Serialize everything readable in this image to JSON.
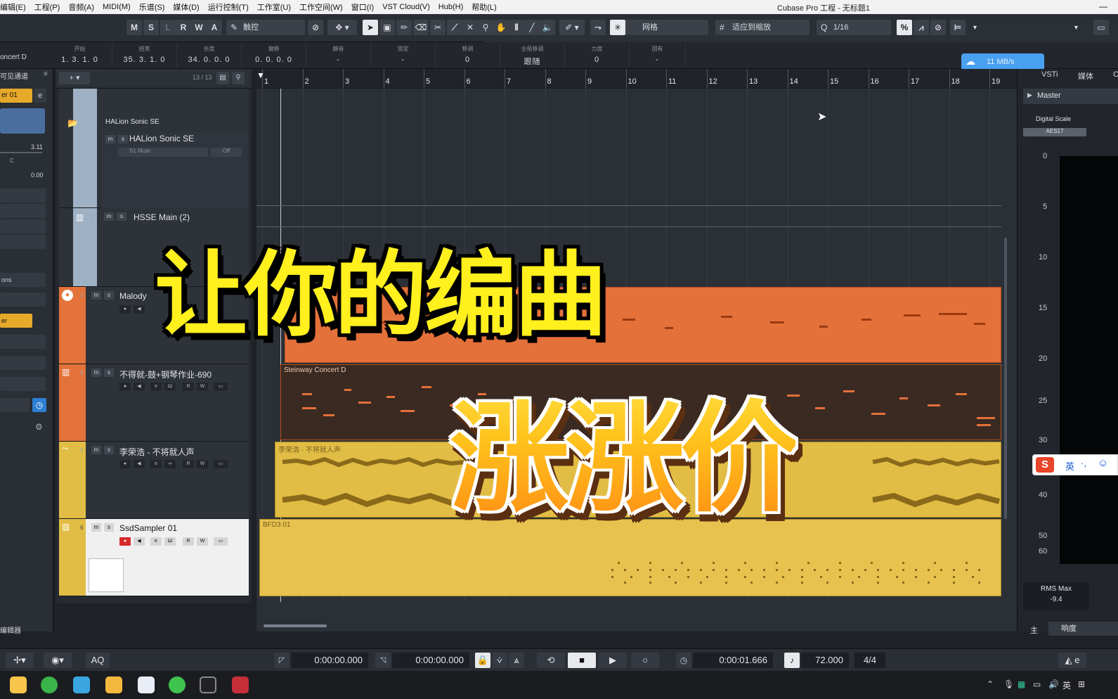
{
  "menubar": {
    "items": [
      "编辑(E)",
      "工程(P)",
      "音频(A)",
      "MIDI(M)",
      "乐谱(S)",
      "媒体(D)",
      "运行控制(T)",
      "工作室(U)",
      "工作空间(W)",
      "窗口(I)",
      "VST Cloud(V)",
      "Hub(H)",
      "帮助(L)"
    ],
    "window_title": "Cubase Pro 工程 - 无标题1"
  },
  "toolbar": {
    "mode_buttons": [
      "M",
      "S",
      "L",
      "R",
      "W",
      "A"
    ],
    "automation_mode": "触控",
    "snap_type": "网格",
    "grid_mode": "适应到缩放",
    "quantize": "1/16"
  },
  "infoline": {
    "track_name": "oncert D",
    "columns": [
      {
        "label": "开始",
        "value": "1. 3. 1.   0"
      },
      {
        "label": "结束",
        "value": "35. 3. 1.   0"
      },
      {
        "label": "长度",
        "value": "34. 0. 0.   0"
      },
      {
        "label": "偏移",
        "value": "0. 0. 0.   0"
      },
      {
        "label": "静音",
        "value": "-"
      },
      {
        "label": "锁定",
        "value": "-"
      },
      {
        "label": "移调",
        "value": "0"
      },
      {
        "label": "全局移调",
        "value": "跟随"
      },
      {
        "label": "力度",
        "value": "0"
      },
      {
        "label": "固有",
        "value": "-"
      }
    ]
  },
  "network_badge": "11 MB/s",
  "inspector": {
    "header": "可见通道",
    "channel": "er 01",
    "volume": "3.11",
    "pan": "C",
    "delay": "0.00",
    "item_a": "ons",
    "item_b": "er",
    "footer": "编辑器"
  },
  "tracklist": {
    "count": "13 / 13",
    "folder_name": "HALion Sonic SE",
    "tracks": [
      {
        "num": "",
        "name": "HALion Sonic SE",
        "sub": "S1 Mute",
        "sub2": "Off"
      },
      {
        "num": "2",
        "name": "HSSE Main (2)"
      },
      {
        "num": "3",
        "name": "Malody"
      },
      {
        "num": "4",
        "name": "不得就-鼓+钢琴作业-690"
      },
      {
        "num": "5",
        "name": "李荣浩 - 不将就人声"
      },
      {
        "num": "6",
        "name": "SsdSampler 01"
      }
    ]
  },
  "ruler": {
    "bars": [
      "1",
      "2",
      "3",
      "4",
      "5",
      "6",
      "7",
      "8",
      "9",
      "10",
      "11",
      "12",
      "13",
      "14",
      "15",
      "16",
      "17",
      "18",
      "19"
    ]
  },
  "events": {
    "piano": "Steinway Concert D",
    "vocal": "李荣浩 - 不将就人声",
    "drums": "BFD3 01"
  },
  "rightzone": {
    "tabs": [
      "VSTi",
      "媒体",
      "C"
    ],
    "master": "Master",
    "scale": "Digital Scale",
    "standard": "AES17",
    "meter_marks": [
      "0",
      "5",
      "10",
      "15",
      "20",
      "25",
      "30",
      "40",
      "50",
      "60"
    ],
    "rms_label": "RMS Max",
    "rms_value": "-9.4",
    "bottom_tabs": [
      "主",
      "响度"
    ]
  },
  "ime": {
    "lang": "英"
  },
  "transport": {
    "left_locator": "0:00:00.000",
    "right_locator": "0:00:00.000",
    "position": "0:00:01.666",
    "tempo": "72.000",
    "signature": "4/4",
    "aq": "AQ"
  },
  "overlay": {
    "line1": "让你的编曲",
    "line2": "涨涨价"
  },
  "colors": {
    "melody_track": "#e3733a",
    "piano_track": "#e3733a",
    "vocal_track": "#e2bd45",
    "drum_track": "#e2bd45",
    "folder_track": "#9fb1c4",
    "overlay_yellow": "#fff01e",
    "overlay_orange": "#ff8a14"
  }
}
